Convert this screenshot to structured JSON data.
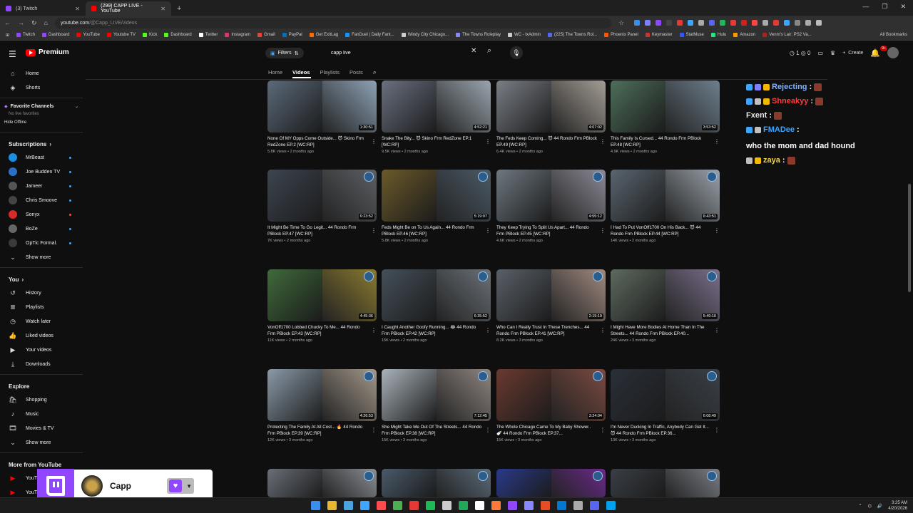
{
  "browser": {
    "tabs": [
      {
        "title": "(3) Twitch",
        "color": "#9146ff",
        "active": false
      },
      {
        "title": "(299) CAPP LIVE - YouTube",
        "color": "#ff0000",
        "active": true
      }
    ],
    "url_host": "youtube.com",
    "url_path": "/@Capp_LIVE/videos",
    "bookmarks": [
      {
        "label": "Twitch",
        "color": "#9146ff"
      },
      {
        "label": "Dashboard",
        "color": "#9146ff"
      },
      {
        "label": "YouTube",
        "color": "#ff0000"
      },
      {
        "label": "Youtube TV",
        "color": "#ff0000"
      },
      {
        "label": "Kick",
        "color": "#53fc18"
      },
      {
        "label": "Dashboard",
        "color": "#53fc18"
      },
      {
        "label": "Twitter",
        "color": "#ffffff"
      },
      {
        "label": "Instagram",
        "color": "#e1306c"
      },
      {
        "label": "Gmail",
        "color": "#ea4335"
      },
      {
        "label": "PayPal",
        "color": "#0070ba"
      },
      {
        "label": "Get ExitLag",
        "color": "#ff6a00"
      },
      {
        "label": "FanDuel | Daily Fant...",
        "color": "#1493ff"
      },
      {
        "label": "Windy City Chicago...",
        "color": "#cccccc"
      },
      {
        "label": "The Towns Roleplay",
        "color": "#8888ff"
      },
      {
        "label": "WC - txAdmin",
        "color": "#cccccc"
      },
      {
        "label": "(225) The Towns Rol...",
        "color": "#5865f2"
      },
      {
        "label": "Phoenix Panel",
        "color": "#ff5500"
      },
      {
        "label": "Keymaster",
        "color": "#cc3333"
      },
      {
        "label": "StatMuse",
        "color": "#3355ff"
      },
      {
        "label": "Hulu",
        "color": "#1ce783"
      },
      {
        "label": "Amazon",
        "color": "#ff9900"
      },
      {
        "label": "Venm's Lair: PS2 Va...",
        "color": "#aa2222"
      }
    ],
    "all_bookmarks": "All Bookmarks"
  },
  "yt": {
    "logo_text": "Premium",
    "filters_label": "Filters",
    "search_value": "capp live",
    "create_label": "Create",
    "notif_count": "9+"
  },
  "sidebar": {
    "main": [
      {
        "label": "Home",
        "icon": "home-icon",
        "glyph": "⌂"
      },
      {
        "label": "Shorts",
        "icon": "shorts-icon",
        "glyph": "◈"
      }
    ],
    "favorites_title": "Favorite Channels",
    "no_live": "No live favorites",
    "hide_offline": "Hide Offline",
    "subscriptions_title": "Subscriptions",
    "subscriptions": [
      {
        "label": "MrBeast",
        "color": "#1a8fe3",
        "live": true
      },
      {
        "label": "Joe Budden TV",
        "color": "#2b6fc4",
        "live": true
      },
      {
        "label": "Jameer",
        "color": "#555555",
        "live": true
      },
      {
        "label": "Chris Smoove",
        "color": "#444444",
        "live": true
      },
      {
        "label": "Sonyx",
        "color": "#d92a2a",
        "live": false
      },
      {
        "label": "BoZe",
        "color": "#666666",
        "live": true
      },
      {
        "label": "OpTic Formal.",
        "color": "#3a3a3a",
        "live": true
      }
    ],
    "show_more": "Show more",
    "you_title": "You",
    "you_items": [
      {
        "label": "History",
        "icon": "history-icon",
        "glyph": "↺"
      },
      {
        "label": "Playlists",
        "icon": "playlists-icon",
        "glyph": "≣"
      },
      {
        "label": "Watch later",
        "icon": "clock-icon",
        "glyph": "◷"
      },
      {
        "label": "Liked videos",
        "icon": "thumbs-up-icon",
        "glyph": "👍"
      },
      {
        "label": "Your videos",
        "icon": "your-videos-icon",
        "glyph": "▶"
      },
      {
        "label": "Downloads",
        "icon": "download-icon",
        "glyph": "⤓"
      }
    ],
    "explore_title": "Explore",
    "explore_items": [
      {
        "label": "Shopping",
        "icon": "shopping-icon",
        "glyph": "🛍"
      },
      {
        "label": "Music",
        "icon": "music-icon",
        "glyph": "♪"
      },
      {
        "label": "Movies & TV",
        "icon": "movies-icon",
        "glyph": "🎞"
      }
    ],
    "show_more_2": "Show more",
    "more_from": "More from YouTube",
    "more_items": [
      "YouTu",
      "YouTu"
    ]
  },
  "channel_tabs": [
    "Home",
    "Videos",
    "Playlists",
    "Posts"
  ],
  "videos": [
    {
      "title": "None Of MY Opps Come Outside... 😈 Skino Frm RedZone EP.2 [WC:RP]",
      "duration": "1:30:51",
      "meta": "5.8K views • 2 months ago",
      "c1": "#5b6a7a",
      "c2": "#8da2b5"
    },
    {
      "title": "Snake The Bity... 😈 Skino Frm RedZone EP.1 [WC:RP]",
      "duration": "4:52:21",
      "meta": "9.5K views • 2 months ago",
      "c1": "#6a7080",
      "c2": "#9aa5ae"
    },
    {
      "title": "The Feds Keep Coming... 😈 44 Rondo Frm PBlock EP.49 [WC:RP]",
      "duration": "4:07:02",
      "meta": "6.4K views • 2 months ago",
      "c1": "#7a7f86",
      "c2": "#a39d94"
    },
    {
      "title": "This Family Is Cursed... 44 Rondo Frm PBlock EP.48 [WC:RP]",
      "duration": "3:53:52",
      "meta": "4.9K views • 2 months ago",
      "c1": "#4d6f5a",
      "c2": "#6d7f8e"
    },
    {
      "title": "It Might Be Time To Go Legit... 44 Rondo Frm PBlock EP.47 [WC:RP]",
      "duration": "6:23:52",
      "meta": "7K views • 2 months ago",
      "c1": "#3d4550",
      "c2": "#5c5f63"
    },
    {
      "title": "Feds Might Be on To Us Again... 44 Rondo Frm PBlock EP.46 [WC:RP]",
      "duration": "5:19:07",
      "meta": "5.8K views • 2 months ago",
      "c1": "#6b5a2a",
      "c2": "#4b5a66"
    },
    {
      "title": "They Keep Trying To Split Us Apart... 44 Rondo Frm PBlock EP.45 [WC:RP]",
      "duration": "4:55:12",
      "meta": "4.6K views • 2 months ago",
      "c1": "#6e7880",
      "c2": "#8c8a95"
    },
    {
      "title": "I Had To Put VonOff1700 On His Back... 😈 44 Rondo Frm PBlock EP.44 [WC:RP]",
      "duration": "6:43:51",
      "meta": "14K views • 2 months ago",
      "c1": "#5a6570",
      "c2": "#9aa3ab"
    },
    {
      "title": "VonOff1700 Lobbed Chucky To Me... 44 Rondo Frm PBlock EP.43 [WC:RP]",
      "duration": "4:45:36",
      "meta": "11K views • 2 months ago",
      "c1": "#3f6a3a",
      "c2": "#8a7a30"
    },
    {
      "title": "I Caught Another Goofy Running... 😂 44 Rondo Frm PBlock EP.42 [WC:RP]",
      "duration": "6:35:52",
      "meta": "15K views • 2 months ago",
      "c1": "#45505a",
      "c2": "#6a7178"
    },
    {
      "title": "Who Can I Really Trust In These Trenches... 44 Rondo Frm PBlock EP.41 [WC:RP]",
      "duration": "2:19:19",
      "meta": "8.2K views • 3 months ago",
      "c1": "#5a6068",
      "c2": "#a08a80"
    },
    {
      "title": "I Might Have More Bodies At Home Than In The Streets... 44 Rondo Frm PBlock EP.40...",
      "duration": "5:49:10",
      "meta": "24K views • 3 months ago",
      "c1": "#5e6a60",
      "c2": "#7a6f8a"
    },
    {
      "title": "Protecting The Family At All Cost... 🔥 44 Rondo Frm PBlock EP.39 [WC:RP]",
      "duration": "4:26:53",
      "meta": "12K views • 3 months ago",
      "c1": "#8a9aa8",
      "c2": "#a3988a"
    },
    {
      "title": "She Might Take Me Out Of The Streets... 44 Rondo Frm PBlock EP.38 [WC:RP]",
      "duration": "7:12:45",
      "meta": "15K views • 3 months ago",
      "c1": "#aab3bb",
      "c2": "#8e8580"
    },
    {
      "title": "The Whole Chicago Came To My Baby Shower.. 🍼 44 Rondo Frm PBlock EP.37...",
      "duration": "3:24:04",
      "meta": "15K views • 3 months ago",
      "c1": "#6a3a30",
      "c2": "#7a4a40"
    },
    {
      "title": "I'm Never Ducking In Traffic, Anybody Can Get It... 😈 44 Rondo Frm PBlock EP.36...",
      "duration": "6:08:49",
      "meta": "13K views • 3 months ago",
      "c1": "#2a3038",
      "c2": "#3a4048"
    },
    {
      "title": "",
      "duration": "",
      "meta": "",
      "c1": "#6a7078",
      "c2": "#8a8e94"
    },
    {
      "title": "",
      "duration": "",
      "meta": "",
      "c1": "#4a5a6a",
      "c2": "#5a6a78"
    },
    {
      "title": "",
      "duration": "",
      "meta": "",
      "c1": "#2a3a8a",
      "c2": "#6a2a8a"
    },
    {
      "title": "",
      "duration": "",
      "meta": "",
      "c1": "#3a3f45",
      "c2": "#7a7e85"
    }
  ],
  "chat": [
    {
      "user": "Rejecting",
      "color": "#7fb2ff",
      "msg": ""
    },
    {
      "user": "Shneakyy",
      "color": "#ff3b3b",
      "msg": ""
    },
    {
      "user": "Fxent",
      "color": "#e6e6e6",
      "msg": ""
    },
    {
      "user": "FMADee",
      "color": "#3ea6ff",
      "msg": "who the mom and dad hound"
    },
    {
      "user": "zaya",
      "color": "#f5d442",
      "msg": ""
    }
  ],
  "twitch_overlay": {
    "name": "Capp"
  },
  "taskbar": {
    "time": "3:25 AM",
    "date": "4/20/2026",
    "icons": [
      "#3b8eea",
      "#e8b730",
      "#4aa3df",
      "#3ea6ff",
      "#ff4b4b",
      "#4caf50",
      "#e53935",
      "#1db954",
      "#cccccc",
      "#23a55a",
      "#ffffff",
      "#ff7a3a",
      "#9146ff",
      "#8888ff",
      "#e44d26",
      "#0078d4",
      "#aaaaaa",
      "#5865f2",
      "#00a2ed"
    ]
  }
}
